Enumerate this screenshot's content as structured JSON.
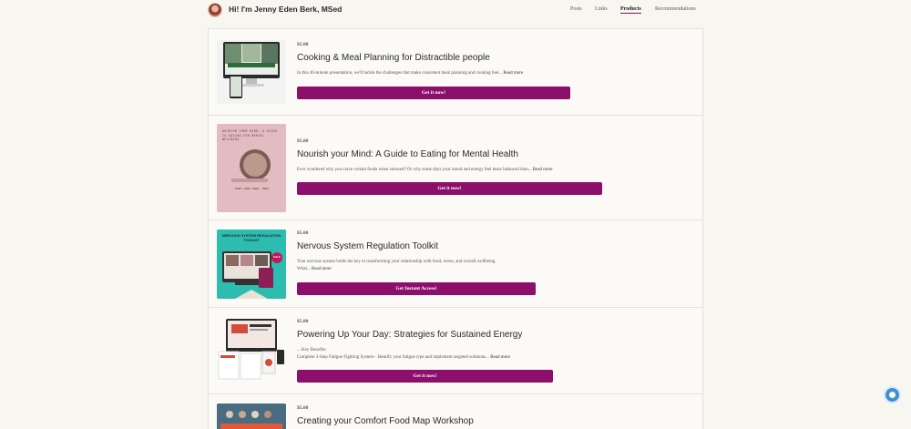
{
  "header": {
    "site_title": "Hi! I'm Jenny Eden Berk, MSed",
    "nav": [
      "Posts",
      "Links",
      "Products",
      "Recommendations"
    ],
    "active_nav": "Products"
  },
  "products": [
    {
      "price": "$5.00",
      "title": "Cooking & Meal Planning for Distractible people",
      "description": "In this 40-minute presentation, we'll tackle the challenges that make consistent meal planning and cooking feel...",
      "more": "Read more",
      "cta": "Get it now!"
    },
    {
      "price": "$5.00",
      "title": "Nourish your Mind: A Guide to Eating for Mental Health",
      "description": "Ever wondered why you crave certain foods when stressed? Or why some days your mood and energy feel more balanced than...",
      "more": "Read more",
      "cta": "Get it now!",
      "thumb_title": "NOURISH YOUR MIND: A GUIDE TO EATING FOR MENTAL WELLNESS",
      "thumb_subtitle": "JENNY EDEN BERK, MSED"
    },
    {
      "price": "$5.00",
      "title": "Nervous System Regulation Toolkit",
      "description_line1": "Your nervous system holds the key to transforming your relationship with food, stress, and overall wellbeing.",
      "description_line2": "What...",
      "more": "Read more",
      "cta": "Get Instant Access!",
      "thumb_title": "NERVOUS SYSTEM REGULATION TOOLKIT",
      "thumb_badge": "SALE"
    },
    {
      "price": "$5.00",
      "title": "Powering Up Your Day: Strategies for Sustained Energy",
      "description_line1": "... Key Benefits:",
      "description_line2": "Complete 3-Step Fatigue Fighting System - Identify your fatigue type and implement targeted solutions...",
      "more": "Read more",
      "cta": "Get it now!"
    },
    {
      "price": "$5.00",
      "title": "Creating your Comfort Food Map Workshop"
    }
  ]
}
